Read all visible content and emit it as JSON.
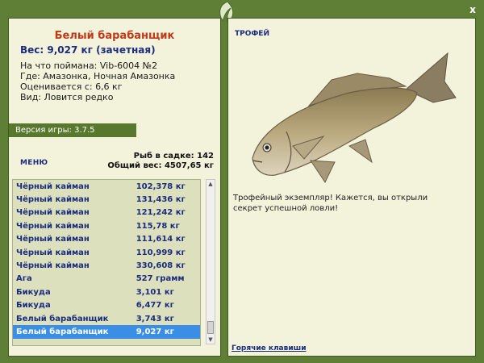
{
  "fish": {
    "name": "Белый барабанщик",
    "weight_line": "Вес: 9,027 кг (зачетная)",
    "bait_line": "На что поймана: Vib-6004 №2",
    "where_line": "Где: Амазонка, Ночная Амазонка",
    "value_line": "Оценивается с: 6,6 кг",
    "kind_line": "Вид: Ловится редко"
  },
  "version": "Версия игры: 3.7.5",
  "menu": {
    "label": "МЕНЮ"
  },
  "stats": {
    "count_line": "Рыб в садке: 142",
    "total_line": "Общий вес: 4507,65 кг"
  },
  "catch_list": [
    {
      "name": "Чёрный кайман",
      "weight": "102,378 кг"
    },
    {
      "name": "Чёрный кайман",
      "weight": "131,436 кг"
    },
    {
      "name": "Чёрный кайман",
      "weight": "121,242 кг"
    },
    {
      "name": "Чёрный кайман",
      "weight": "115,78 кг"
    },
    {
      "name": "Чёрный кайман",
      "weight": "111,614 кг"
    },
    {
      "name": "Чёрный кайман",
      "weight": "110,999 кг"
    },
    {
      "name": "Чёрный кайман",
      "weight": "330,608 кг"
    },
    {
      "name": "Ага",
      "weight": "527 грамм"
    },
    {
      "name": "Бикуда",
      "weight": "3,101 кг"
    },
    {
      "name": "Бикуда",
      "weight": "6,477 кг"
    },
    {
      "name": "Белый барабанщик",
      "weight": "3,743 кг"
    },
    {
      "name": "Белый барабанщик",
      "weight": "9,027 кг",
      "selected": true
    }
  ],
  "trophy": {
    "title": "ТРОФЕЙ",
    "text": "Трофейный экземпляр! Кажется, вы открыли секрет успешной ловли!"
  },
  "hotkeys": "Горячие клавиши",
  "close_label": "x",
  "colors": {
    "frame": "#5f7f37",
    "panel": "#f3f3dc",
    "accent_red": "#c0391b",
    "accent_blue": "#1b2c7e",
    "selected_row": "#3b8ee6"
  }
}
